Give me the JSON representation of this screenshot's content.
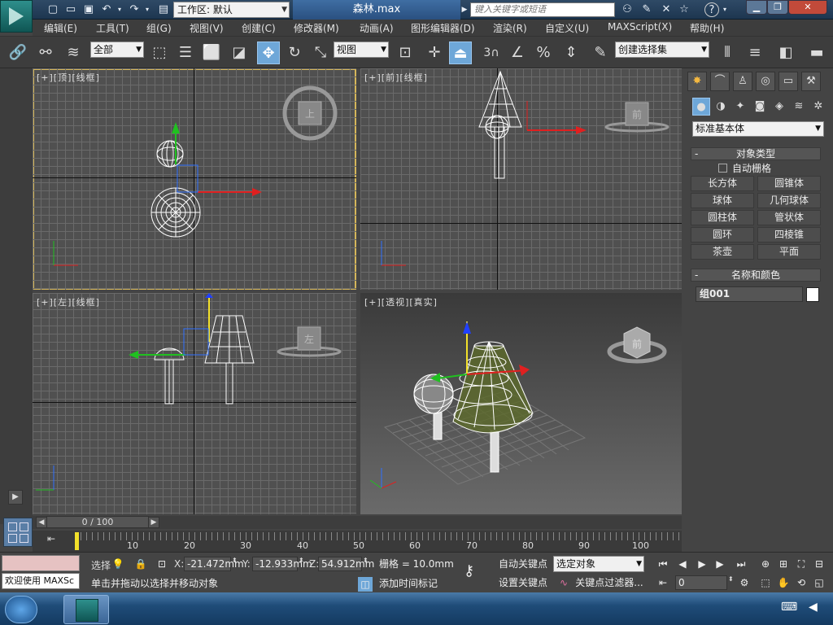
{
  "title_bar": {
    "workspace_label": "工作区: 默认",
    "file_name": "森林.max",
    "search_placeholder": "键入关键字或短语"
  },
  "menu": [
    "编辑(E)",
    "工具(T)",
    "组(G)",
    "视图(V)",
    "创建(C)",
    "修改器(M)",
    "动画(A)",
    "图形编辑器(D)",
    "渲染(R)",
    "自定义(U)",
    "MAXScript(X)",
    "帮助(H)"
  ],
  "toolbar": {
    "selection_filter": "全部",
    "reference_coord": "视图",
    "named_selection_set": "创建选择集",
    "snap_label": "3"
  },
  "viewports": [
    {
      "label": "[+][顶][线框]",
      "viewcube_face": "上"
    },
    {
      "label": "[+][前][线框]",
      "viewcube_face": "前"
    },
    {
      "label": "[+][左][线框]",
      "viewcube_face": "左"
    },
    {
      "label": "[+][透视][真实]",
      "viewcube_face": "前"
    }
  ],
  "command_panel": {
    "category": "标准基本体",
    "object_type_header": "对象类型",
    "auto_grid": "自动栅格",
    "object_buttons": [
      "长方体",
      "圆锥体",
      "球体",
      "几何球体",
      "圆柱体",
      "管状体",
      "圆环",
      "四棱锥",
      "茶壶",
      "平面"
    ],
    "name_color_header": "名称和颜色",
    "object_name": "组001",
    "object_color": "#ffffff"
  },
  "timeline": {
    "slider_label": "0 / 100",
    "ticks": [
      "10",
      "20",
      "30",
      "40",
      "50",
      "60",
      "70",
      "80",
      "90",
      "100"
    ]
  },
  "status": {
    "script_listener": "欢迎使用 MAXSc",
    "selection_label": "选择",
    "x_label": "X:",
    "x_value": "-21.472mm",
    "y_label": "Y:",
    "y_value": "-12.933mm",
    "z_label": "Z:",
    "z_value": "54.912mm",
    "grid": "栅格 = 10.0mm",
    "prompt": "单击并拖动以选择并移动对象",
    "add_time_tag": "添加时间标记",
    "auto_key": "自动关键点",
    "set_key": "设置关键点",
    "key_mode": "选定对象",
    "key_filters": "关键点过滤器...",
    "current_frame": "0"
  }
}
